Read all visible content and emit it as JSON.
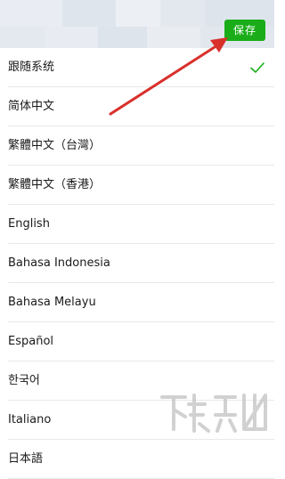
{
  "header": {
    "save_label": "保存"
  },
  "languages": [
    {
      "label": "跟随系统",
      "selected": true
    },
    {
      "label": "简体中文",
      "selected": false
    },
    {
      "label": "繁體中文（台灣）",
      "selected": false
    },
    {
      "label": "繁體中文（香港）",
      "selected": false
    },
    {
      "label": "English",
      "selected": false
    },
    {
      "label": "Bahasa Indonesia",
      "selected": false
    },
    {
      "label": "Bahasa Melayu",
      "selected": false
    },
    {
      "label": "Español",
      "selected": false
    },
    {
      "label": "한국어",
      "selected": false
    },
    {
      "label": "Italiano",
      "selected": false
    },
    {
      "label": "日本語",
      "selected": false
    }
  ],
  "colors": {
    "accent": "#1aad19",
    "annotation": "#d9302c"
  },
  "icons": {
    "check": "check-icon",
    "arrow": "annotation-arrow",
    "watermark": "watermark-logo"
  }
}
